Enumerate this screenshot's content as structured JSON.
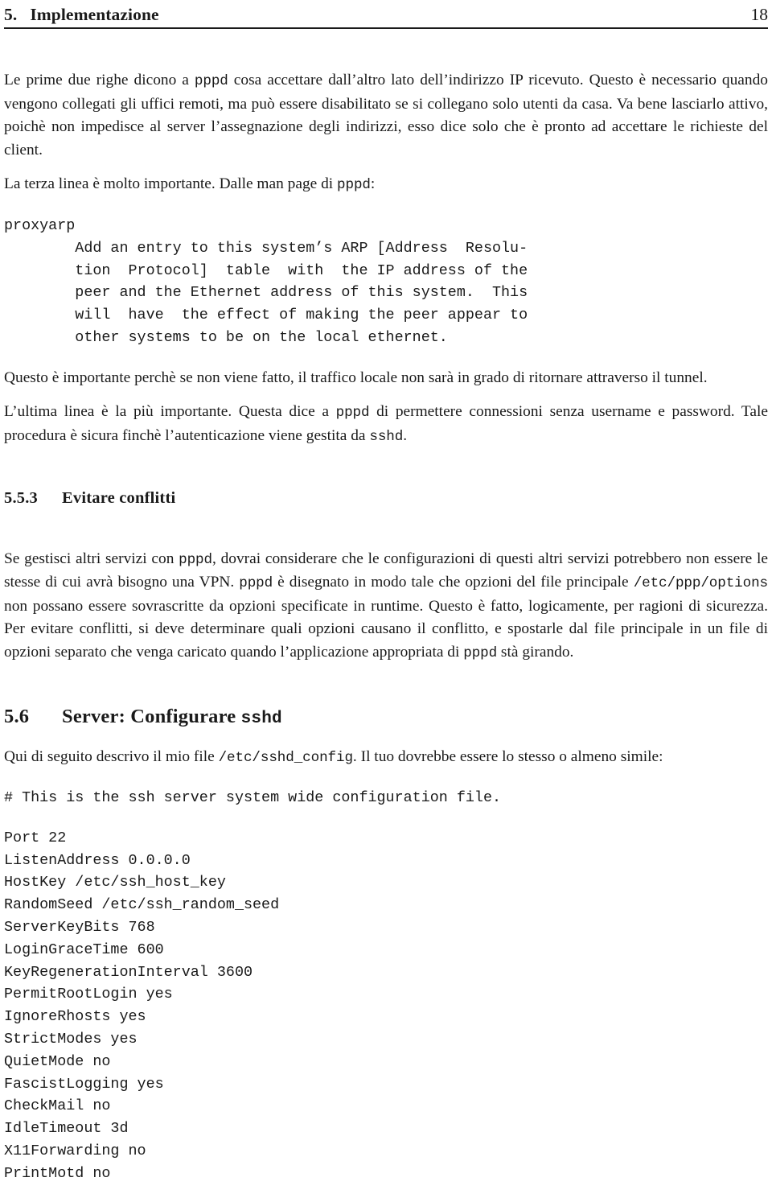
{
  "header": {
    "section_number": "5.",
    "section_title": "Implementazione",
    "page_number": "18"
  },
  "content": {
    "para1": "Le prime due righe dicono a pppd cosa accettare dall’altro lato dell’indirizzo IP ricevuto. Questo è necessario quando vengono collegati gli uffici remoti, ma può essere disabilitato se si collegano solo utenti da casa. Va bene lasciarlo attivo, poichè non impedisce al server l’assegnazione degli indirizzi, esso dice solo che è pronto ad accettare le richieste del client.",
    "para1_parts": {
      "a": "Le prime due righe dicono a ",
      "code1": "pppd",
      "b": " cosa accettare dall’altro lato dell’indirizzo IP ricevuto. Questo è necessario quando vengono collegati gli uffici remoti, ma può essere disabilitato se si collegano solo utenti da casa. Va bene lasciarlo attivo, poichè non impedisce al server l’assegnazione degli indirizzi, esso dice solo che è pronto ad accettare le richieste del client."
    },
    "para2_parts": {
      "a": "La terza linea è molto importante. Dalle man page di ",
      "code1": "pppd",
      "b": ":"
    },
    "manpage_block": "proxyarp\n        Add an entry to this system’s ARP [Address  Resolu-\n        tion  Protocol]  table  with  the IP address of the\n        peer and the Ethernet address of this system.  This\n        will  have  the effect of making the peer appear to\n        other systems to be on the local ethernet.",
    "para3": "Questo è importante perchè se non viene fatto, il traffico locale non sarà in grado di ritornare attraverso il tunnel.",
    "para4_parts": {
      "a": "L’ultima linea è la più importante. Questa dice a ",
      "code1": "pppd",
      "b": " di permettere connessioni senza username e password. Tale procedura è sicura finchè l’autenticazione viene gestita da ",
      "code2": "sshd",
      "c": "."
    },
    "heading_553": {
      "number": "5.5.3",
      "title": "Evitare conflitti"
    },
    "para5_parts": {
      "a": "Se gestisci altri servizi con ",
      "code1": "pppd",
      "b": ", dovrai considerare che le configurazioni di questi altri servizi potrebbero non essere le stesse di cui avrà bisogno una VPN. ",
      "code2": "pppd",
      "c": " è disegnato in modo tale che opzioni del file principale ",
      "code3": "/etc/ppp/options",
      "d": " non possano essere sovrascritte da opzioni specificate in runtime. Questo è fatto, logicamente, per ragioni di sicurezza. Per evitare conflitti, si deve determinare quali opzioni causano il conflitto, e spostarle dal file principale in un file di opzioni separato che venga caricato quando l’applicazione appropriata di ",
      "code4": "pppd",
      "e": " stà girando."
    },
    "heading_56": {
      "number": "5.6",
      "title_a": "Server: Configurare ",
      "title_mono": "sshd"
    },
    "para6_parts": {
      "a": "Qui di seguito descrivo il mio file ",
      "code1": "/etc/sshd_config",
      "b": ". Il tuo dovrebbe essere lo stesso o almeno simile:"
    },
    "sshd_comment": "# This is the ssh server system wide configuration file.",
    "sshd_config_lines": [
      "Port 22",
      "ListenAddress 0.0.0.0",
      "HostKey /etc/ssh_host_key",
      "RandomSeed /etc/ssh_random_seed",
      "ServerKeyBits 768",
      "LoginGraceTime 600",
      "KeyRegenerationInterval 3600",
      "PermitRootLogin yes",
      "IgnoreRhosts yes",
      "StrictModes yes",
      "QuietMode no",
      "FascistLogging yes",
      "CheckMail no",
      "IdleTimeout 3d",
      "X11Forwarding no",
      "PrintMotd no"
    ]
  }
}
